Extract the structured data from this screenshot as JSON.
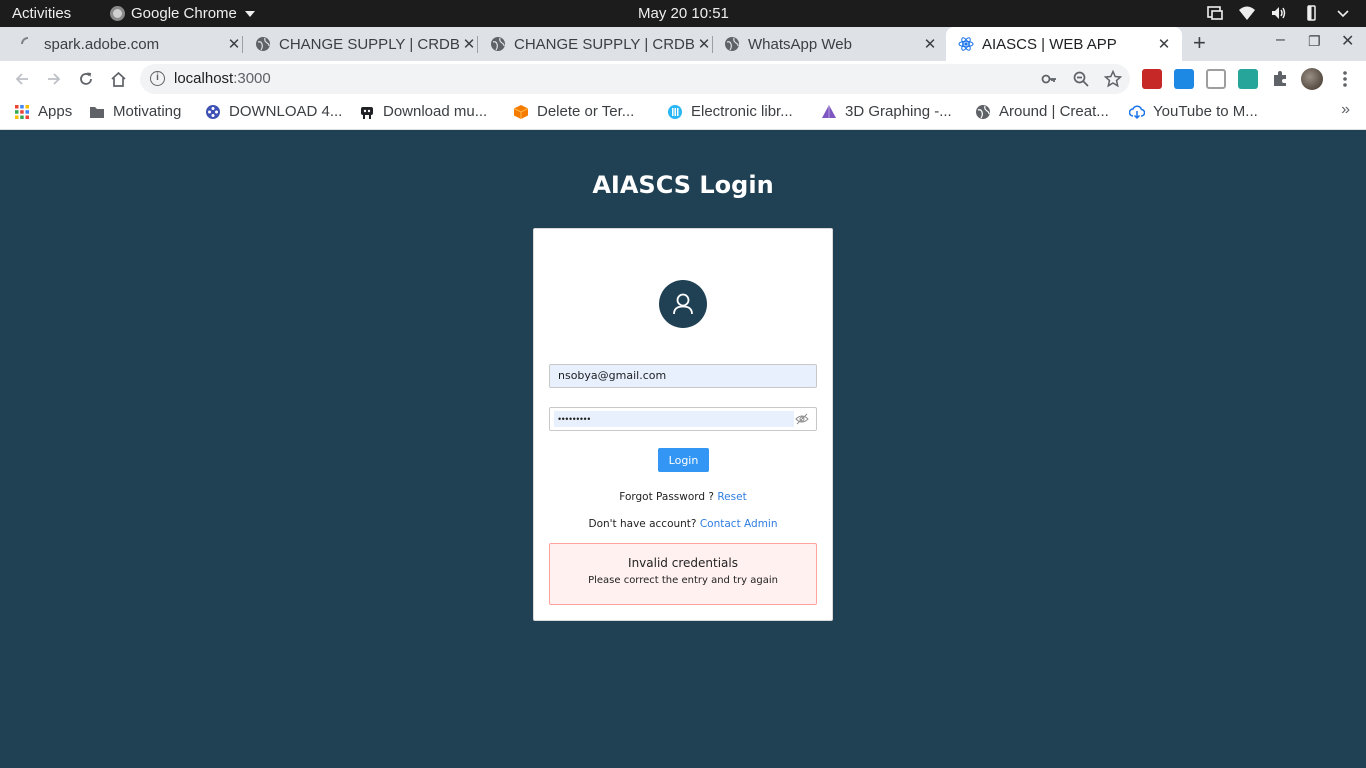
{
  "system_bar": {
    "activities": "Activities",
    "app_name": "Google Chrome",
    "clock": "May 20  10:51"
  },
  "tabs": [
    {
      "title": "spark.adobe.com",
      "active": false
    },
    {
      "title": "CHANGE SUPPLY | CRDB",
      "active": false
    },
    {
      "title": "CHANGE SUPPLY | CRDB",
      "active": false
    },
    {
      "title": "WhatsApp Web",
      "active": false
    },
    {
      "title": "AIASCS | WEB APP",
      "active": true
    }
  ],
  "address_bar": {
    "host": "localhost",
    "port": ":3000"
  },
  "bookmarks": [
    {
      "label": "Apps",
      "icon": "apps-grid-icon"
    },
    {
      "label": "Motivating",
      "icon": "folder-icon"
    },
    {
      "label": "DOWNLOAD 4...",
      "icon": "film-reel-icon"
    },
    {
      "label": "Download mu...",
      "icon": "robot-icon"
    },
    {
      "label": "Delete or Ter...",
      "icon": "orange-cube-icon"
    },
    {
      "label": "Electronic libr...",
      "icon": "library-icon"
    },
    {
      "label": "3D Graphing -...",
      "icon": "triangle-icon"
    },
    {
      "label": "Around | Creat...",
      "icon": "globe-icon"
    },
    {
      "label": "YouTube to M...",
      "icon": "cloud-download-icon"
    }
  ],
  "login": {
    "title": "AIASCS Login",
    "email_value": "nsobya@gmail.com",
    "password_mask": "•••••••••",
    "login_label": "Login",
    "forgot_text": "Forgot Password ?",
    "reset_label": "Reset",
    "no_account_text": "Don't have account?",
    "contact_label": "Contact Admin",
    "error_title": "Invalid credentials",
    "error_desc": "Please correct the entry and try again"
  },
  "colors": {
    "page_background": "#1f4153",
    "primary_button": "#3396f5",
    "link": "#2f7de1",
    "error_background": "#fff1f0",
    "error_border": "#ffa39e"
  }
}
